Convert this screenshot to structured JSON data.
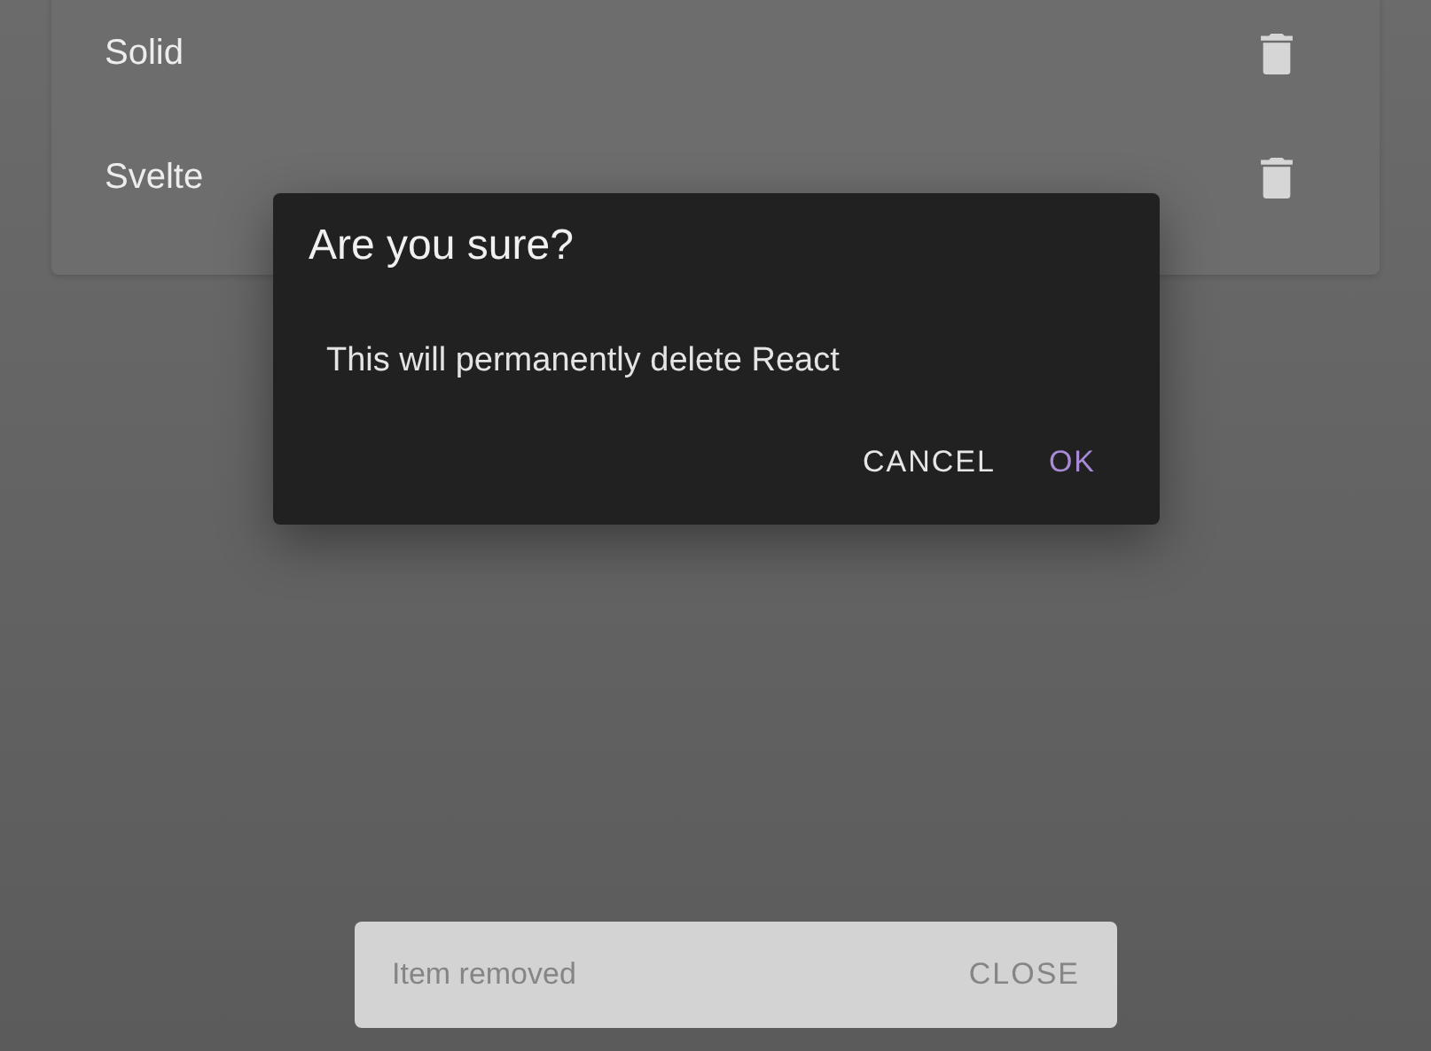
{
  "list": {
    "items": [
      {
        "label": "Solid"
      },
      {
        "label": "Svelte"
      }
    ]
  },
  "dialog": {
    "title": "Are you sure?",
    "message": "This will permanently delete React",
    "buttons": [
      {
        "label": "CANCEL",
        "kind": "text"
      },
      {
        "label": "OK",
        "kind": "primary"
      }
    ]
  },
  "snackbar": {
    "message": "Item removed",
    "action": "CLOSE"
  }
}
